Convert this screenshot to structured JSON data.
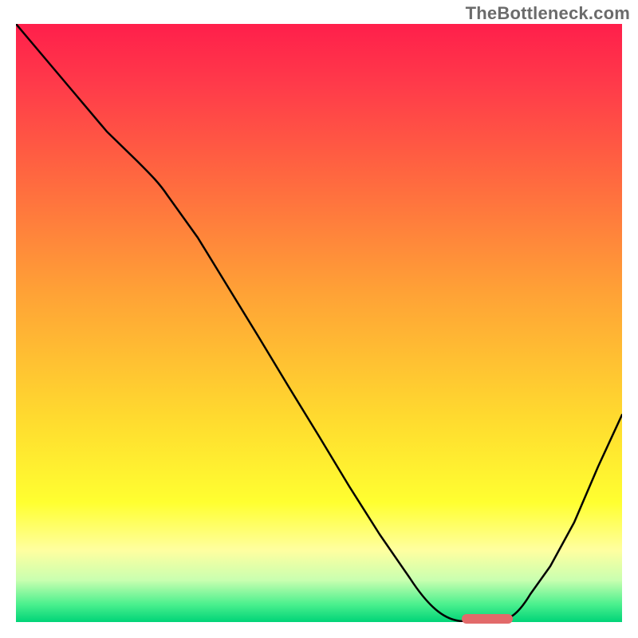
{
  "watermark": "TheBottleneck.com",
  "chart_data": {
    "type": "line",
    "title": "",
    "xlabel": "",
    "ylabel": "",
    "x": [
      0.0,
      0.05,
      0.1,
      0.15,
      0.2,
      0.25,
      0.3,
      0.35,
      0.4,
      0.45,
      0.5,
      0.55,
      0.6,
      0.65,
      0.7,
      0.73,
      0.78,
      0.82,
      0.84,
      0.88,
      0.92,
      0.96,
      1.0
    ],
    "y": [
      1.0,
      0.94,
      0.88,
      0.82,
      0.77,
      0.74,
      0.67,
      0.59,
      0.51,
      0.43,
      0.35,
      0.27,
      0.19,
      0.12,
      0.05,
      0.01,
      0.0,
      0.0,
      0.02,
      0.09,
      0.17,
      0.26,
      0.35
    ],
    "ylim": [
      0,
      1
    ],
    "xlim": [
      0,
      1
    ],
    "background_gradient": {
      "top": "#ff1f4b",
      "mid": "#ffd82f",
      "bottom": "#00d478"
    },
    "marker": {
      "x_start": 0.74,
      "x_end": 0.82,
      "y": 0.0,
      "color": "#e26a6a"
    },
    "legend": false,
    "grid": false
  }
}
